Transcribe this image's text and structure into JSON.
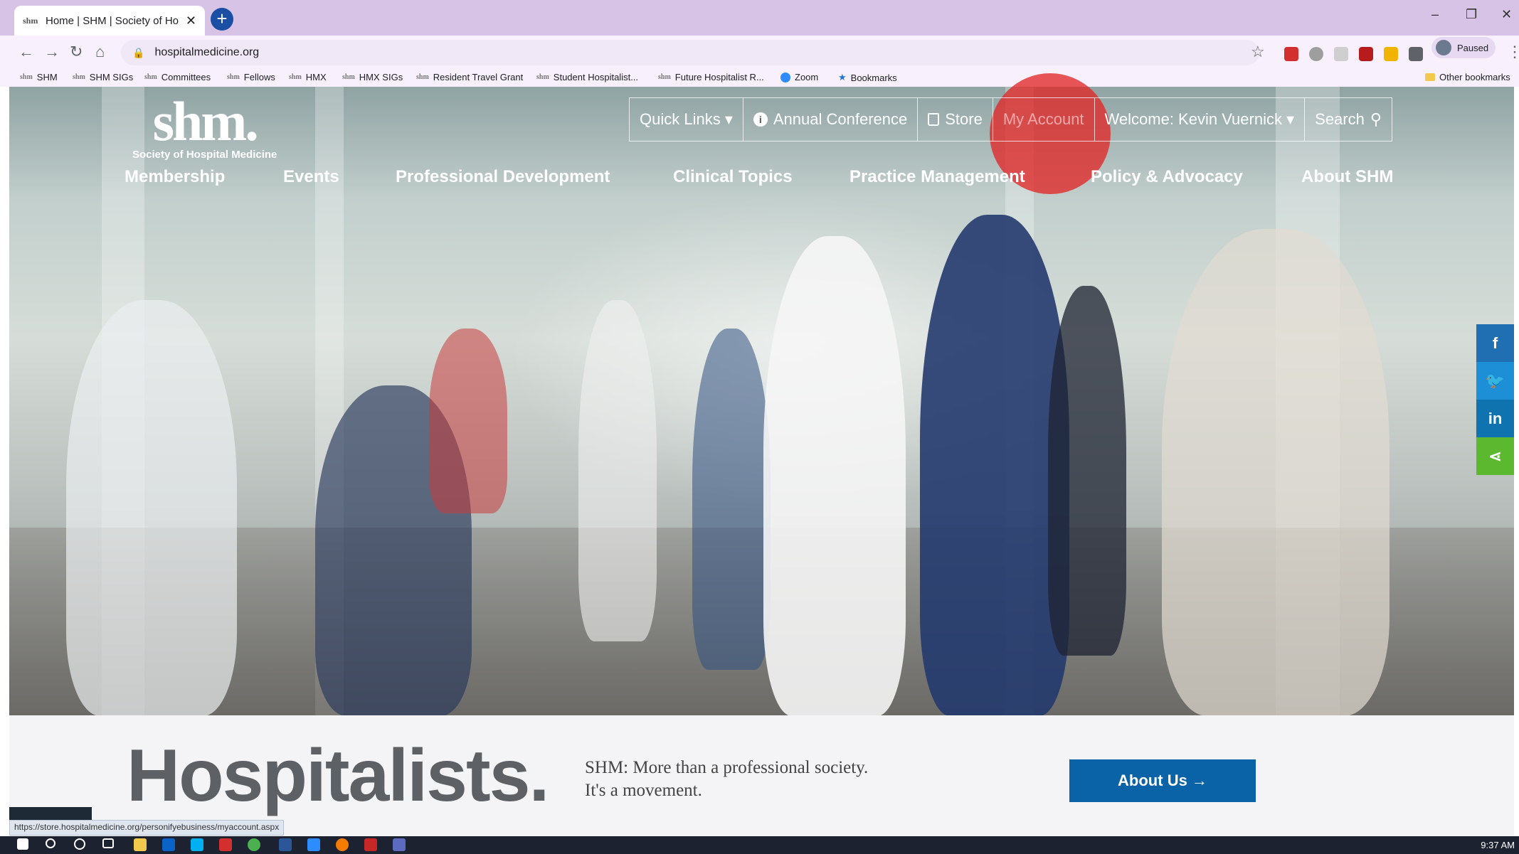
{
  "browser": {
    "tab_favicon": "shm",
    "tab_title": "Home | SHM | Society of Hospita",
    "tab_close": "✕",
    "new_tab": "+",
    "url": "hospitalmedicine.org",
    "profile_label": "Paused",
    "status_url": "https://store.hospitalmedicine.org/personifyebusiness/myaccount.aspx"
  },
  "bookmarks": [
    {
      "icon": "shm",
      "label": "SHM"
    },
    {
      "icon": "shm",
      "label": "SHM SIGs"
    },
    {
      "icon": "shm",
      "label": "Committees"
    },
    {
      "icon": "shm",
      "label": "Fellows"
    },
    {
      "icon": "shm",
      "label": "HMX"
    },
    {
      "icon": "shm",
      "label": "HMX SIGs"
    },
    {
      "icon": "shm",
      "label": "Resident Travel Grant"
    },
    {
      "icon": "shm",
      "label": "Student Hospitalist..."
    },
    {
      "icon": "shm",
      "label": "Future Hospitalist R..."
    },
    {
      "icon": "zoom-icon",
      "label": "Zoom"
    },
    {
      "icon": "star-icon",
      "label": "Bookmarks"
    },
    {
      "icon": "folder-icon",
      "label": "Other bookmarks"
    }
  ],
  "site": {
    "logo_mark": "shm.",
    "logo_subtitle": "Society of Hospital Medicine",
    "utility_nav": {
      "quick_links": "Quick Links ▾",
      "annual_conference": "Annual Conference",
      "store": "Store",
      "my_account": "My Account",
      "welcome": "Welcome: Kevin Vuernick ▾",
      "search": "Search"
    },
    "main_nav": [
      "Membership",
      "Events",
      "Professional Development",
      "Clinical Topics",
      "Practice Management",
      "Policy & Advocacy",
      "About SHM"
    ],
    "social": [
      "f",
      "t",
      "in",
      "share"
    ],
    "hero_word": "Hospitalists.",
    "tagline_line1": "SHM: More than a professional society.",
    "tagline_line2": "It's a movement.",
    "about_button": "About Us →"
  },
  "system": {
    "clock": "9:37 AM"
  },
  "colors": {
    "tab_strip": "#d7c3e5",
    "about_button": "#0a63a6",
    "facebook": "#1f6fb2",
    "twitter": "#1d8fd6",
    "linkedin": "#0f73b0",
    "share": "#5cb82e",
    "cursor_highlight": "#e02828"
  }
}
